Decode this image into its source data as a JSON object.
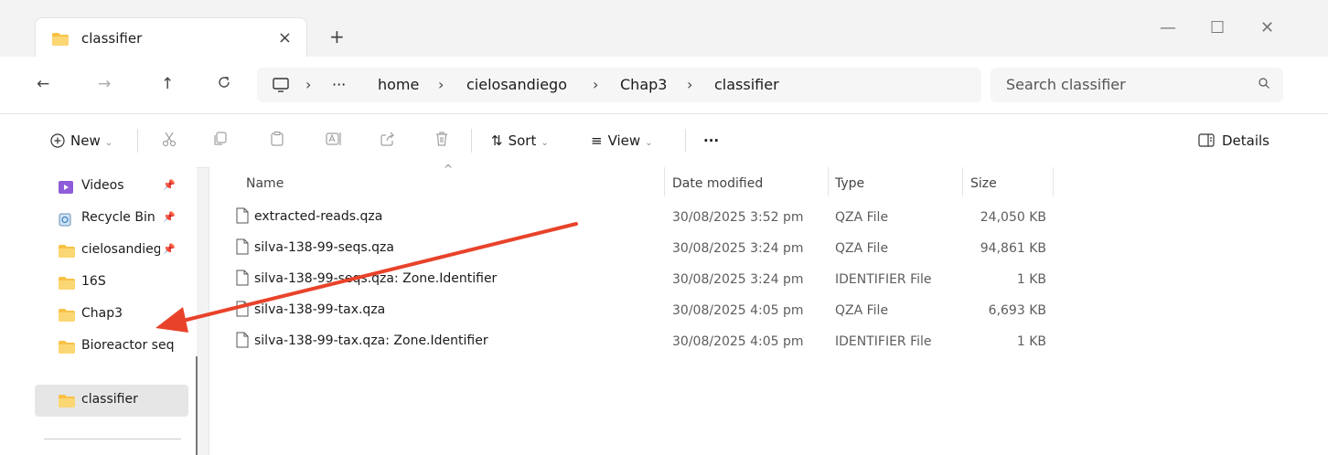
{
  "tab": {
    "title": "classifier",
    "close": "×",
    "new_tab": "+"
  },
  "window_controls": {
    "minimize": "—",
    "maximize": "☐",
    "close": "✕"
  },
  "nav": {
    "back": "←",
    "forward": "→",
    "up": "↑",
    "refresh": "C",
    "breadcrumbs": [
      "home",
      "cielosandiego",
      "Chap3",
      "classifier"
    ],
    "overflow": "···",
    "separator": "›"
  },
  "search": {
    "placeholder": "Search classifier"
  },
  "commandbar": {
    "new_label": "New",
    "sort_label": "Sort",
    "view_label": "View",
    "more_label": "···",
    "details_label": "Details"
  },
  "sidebar": {
    "items": [
      {
        "label": "Videos",
        "icon": "videos-icon",
        "pinned": true
      },
      {
        "label": "Recycle Bin",
        "icon": "recycle-bin-icon",
        "pinned": true
      },
      {
        "label": "cielosandiego",
        "icon": "folder-icon",
        "pinned": true
      },
      {
        "label": "16S",
        "icon": "folder-icon",
        "pinned": false
      },
      {
        "label": "Chap3",
        "icon": "folder-icon",
        "pinned": false
      },
      {
        "label": "Bioreactor seq",
        "icon": "folder-icon",
        "pinned": false
      },
      {
        "label": "classifier",
        "icon": "folder-icon",
        "pinned": false,
        "active": true
      }
    ]
  },
  "columns": {
    "name": "Name",
    "date": "Date modified",
    "type": "Type",
    "size": "Size"
  },
  "files": [
    {
      "name": "extracted-reads.qza",
      "date": "30/08/2025 3:52 pm",
      "type": "QZA File",
      "size": "24,050 KB"
    },
    {
      "name": "silva-138-99-seqs.qza",
      "date": "30/08/2025 3:24 pm",
      "type": "QZA File",
      "size": "94,861 KB"
    },
    {
      "name": "silva-138-99-seqs.qza꞉ Zone.Identifier",
      "date": "30/08/2025 3:24 pm",
      "type": "IDENTIFIER File",
      "size": "1 KB"
    },
    {
      "name": "silva-138-99-tax.qza",
      "date": "30/08/2025 4:05 pm",
      "type": "QZA File",
      "size": "6,693 KB"
    },
    {
      "name": "silva-138-99-tax.qza꞉ Zone.Identifier",
      "date": "30/08/2025 4:05 pm",
      "type": "IDENTIFIER File",
      "size": "1 KB"
    }
  ],
  "colors": {
    "folder": "#f8c146",
    "annotation_arrow": "#e8432a",
    "accent": "#0067c0"
  }
}
